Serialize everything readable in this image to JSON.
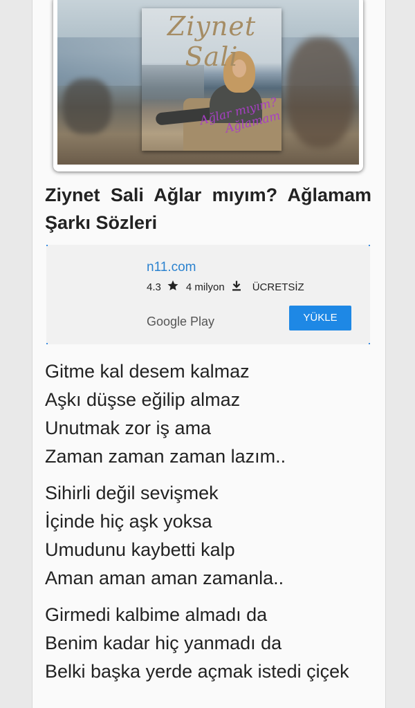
{
  "cover": {
    "artist_script": "Ziynet Sali",
    "album_script_line1": "Ağlar mıyım?",
    "album_script_line2": "Ağlamam"
  },
  "article": {
    "title": "Ziynet Sali Ağlar mıyım? Ağlamam Şarkı Sözleri"
  },
  "ad": {
    "site": "n11.com",
    "rating": "4.3",
    "downloads": "4 milyon",
    "price": "ÜCRETSİZ",
    "store": "Google Play",
    "button_label": "YÜKLE"
  },
  "lyrics": {
    "stanzas": [
      {
        "lines": [
          "Gitme kal desem kalmaz",
          "Aşkı düşse eğilip almaz",
          "Unutmak zor iş ama",
          "Zaman zaman zaman lazım.."
        ]
      },
      {
        "lines": [
          "Sihirli değil sevişmek",
          "İçinde hiç aşk yoksa",
          "Umudunu kaybetti kalp",
          "Aman aman aman zamanla.."
        ]
      },
      {
        "lines": [
          "Girmedi kalbime almadı da",
          "Benim kadar hiç yanmadı da",
          "Belki başka yerde açmak istedi çiçek"
        ]
      }
    ]
  },
  "icons": {
    "star": "star-icon",
    "download": "download-icon"
  },
  "colors": {
    "link": "#2b82cf",
    "button": "#1e88e5",
    "album_subtitle": "#a73fc4"
  }
}
